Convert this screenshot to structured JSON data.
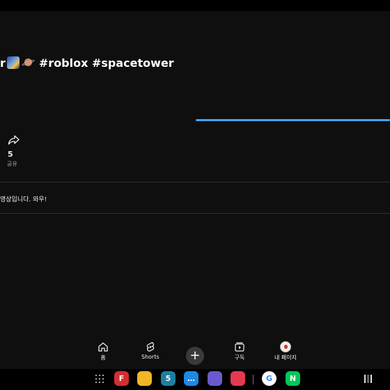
{
  "video": {
    "title_prefix": "r",
    "title_tags": "#roblox #spacetower"
  },
  "progress": {
    "fraction": 1.0
  },
  "actions": {
    "share": {
      "count": "5",
      "label": "공유"
    }
  },
  "comment": {
    "text": "영상입니다. 와우!"
  },
  "bottom_nav": {
    "home_label": "홈",
    "shorts_label": "Shorts",
    "create_label": "+",
    "subscriptions_label": "구독",
    "profile_label": "내 페이지"
  },
  "dock": {
    "apps": [
      {
        "name": "flipboard",
        "color": "#d32f2f",
        "glyph": "F"
      },
      {
        "name": "my-files",
        "color": "#f2b529",
        "glyph": ""
      },
      {
        "name": "calendar",
        "color": "#1d7fa3",
        "glyph": "5"
      },
      {
        "name": "messages",
        "color": "#1e88e5",
        "glyph": "…"
      },
      {
        "name": "internet",
        "color": "#6a5acd",
        "glyph": ""
      },
      {
        "name": "camera",
        "color": "#e53950",
        "glyph": ""
      },
      {
        "name": "google",
        "color": "#ffffff",
        "glyph": "G"
      },
      {
        "name": "naver",
        "color": "#03c75a",
        "glyph": "N"
      }
    ]
  },
  "colors": {
    "background": "#0f0f0f",
    "progress": "#3ea6ff"
  }
}
